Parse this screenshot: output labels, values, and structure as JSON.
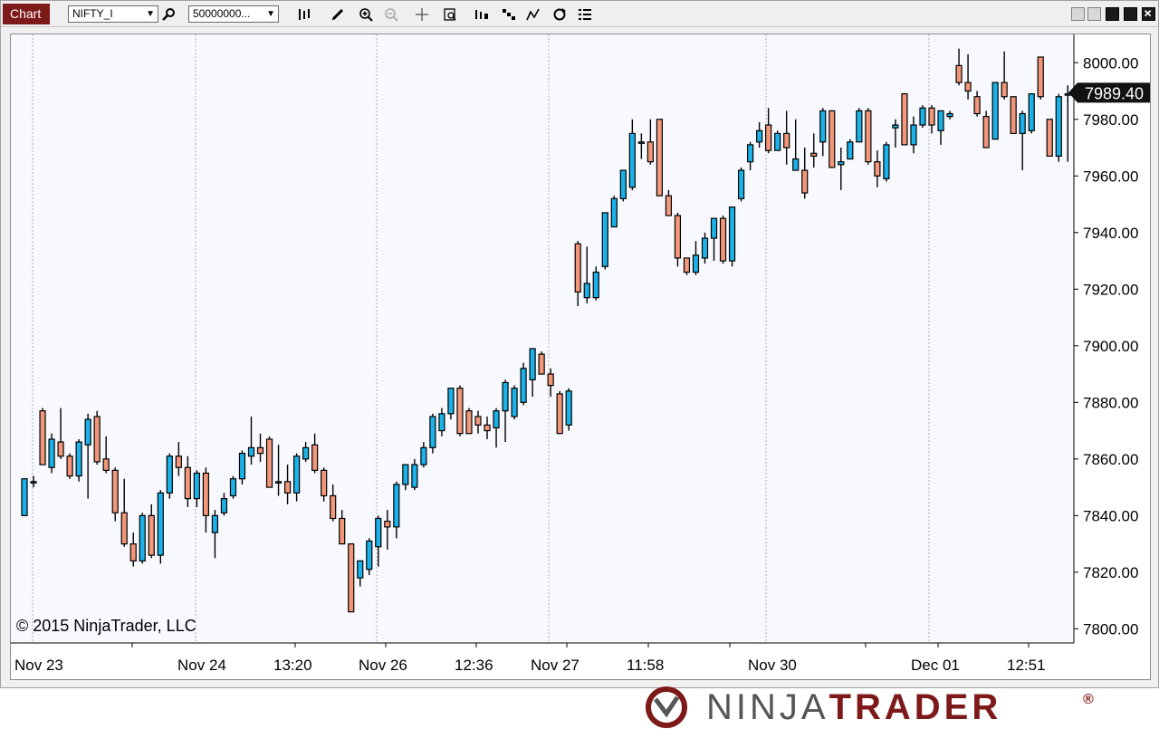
{
  "toolbar": {
    "tab_label": "Chart",
    "instrument_value": "NIFTY_I",
    "bartype_value": "50000000...",
    "icons": [
      "search-icon",
      "bars-type-icon",
      "pencil-icon",
      "zoom-in-icon",
      "zoom-out-icon",
      "crosshair-icon",
      "data-box-icon",
      "bar-spacing-icon",
      "chart-style-icon",
      "indicators-icon",
      "refresh-icon",
      "properties-icon"
    ]
  },
  "chart": {
    "copyright": "© 2015 NinjaTrader, LLC",
    "last_price_label": "7989.40"
  },
  "logo": {
    "part1": "NINJA",
    "part2": "TRADER",
    "reg": "®"
  },
  "colors": {
    "up": "#1ab2e8",
    "down": "#f2977a",
    "brand": "#7e1919",
    "grid": "#b0b0b0",
    "price_tag": "#111111"
  },
  "chart_data": {
    "type": "candlestick",
    "ylim": [
      7795,
      8010
    ],
    "y_ticks": [
      "7800.00",
      "7820.00",
      "7840.00",
      "7860.00",
      "7880.00",
      "7900.00",
      "7920.00",
      "7940.00",
      "7960.00",
      "7980.00",
      "8000.00"
    ],
    "x_labels": [
      "Nov 23",
      "Nov 24",
      "13:20",
      "Nov 26",
      "12:36",
      "Nov 27",
      "11:58",
      "Nov 30",
      "Dec 01",
      "12:51"
    ],
    "last_price": 7989.4,
    "bars": [
      [
        7840,
        7853,
        7840,
        7853
      ],
      [
        7852,
        7854,
        7850,
        7852
      ],
      [
        7877,
        7878,
        7858,
        7858
      ],
      [
        7857,
        7869,
        7855,
        7867
      ],
      [
        7866,
        7878,
        7860,
        7861
      ],
      [
        7861,
        7862,
        7853,
        7854
      ],
      [
        7854,
        7867,
        7852,
        7866
      ],
      [
        7865,
        7876,
        7846,
        7874
      ],
      [
        7875,
        7877,
        7858,
        7859
      ],
      [
        7860,
        7868,
        7855,
        7856
      ],
      [
        7856,
        7857,
        7838,
        7841
      ],
      [
        7841,
        7853,
        7829,
        7830
      ],
      [
        7830,
        7834,
        7822,
        7824
      ],
      [
        7824,
        7841,
        7823,
        7840
      ],
      [
        7840,
        7844,
        7825,
        7826
      ],
      [
        7826,
        7849,
        7823,
        7848
      ],
      [
        7848,
        7862,
        7846,
        7861
      ],
      [
        7861,
        7866,
        7854,
        7857
      ],
      [
        7857,
        7861,
        7843,
        7846
      ],
      [
        7846,
        7856,
        7843,
        7855
      ],
      [
        7855,
        7857,
        7834,
        7840
      ],
      [
        7834,
        7842,
        7825,
        7840
      ],
      [
        7841,
        7848,
        7840,
        7846
      ],
      [
        7847,
        7854,
        7846,
        7853
      ],
      [
        7853,
        7863,
        7851,
        7862
      ],
      [
        7861,
        7875,
        7858,
        7864
      ],
      [
        7864,
        7869,
        7859,
        7862
      ],
      [
        7867,
        7868,
        7850,
        7850
      ],
      [
        7852,
        7865,
        7847,
        7852
      ],
      [
        7852,
        7858,
        7844,
        7848
      ],
      [
        7848,
        7862,
        7845,
        7861
      ],
      [
        7860,
        7866,
        7859,
        7864
      ],
      [
        7865,
        7869,
        7855,
        7856
      ],
      [
        7856,
        7857,
        7845,
        7847
      ],
      [
        7847,
        7851,
        7838,
        7839
      ],
      [
        7839,
        7842,
        7830,
        7830
      ],
      [
        7830,
        7830,
        7806,
        7806
      ],
      [
        7818,
        7821,
        7815,
        7824
      ],
      [
        7821,
        7832,
        7819,
        7831
      ],
      [
        7829,
        7840,
        7822,
        7839
      ],
      [
        7838,
        7842,
        7828,
        7836
      ],
      [
        7836,
        7852,
        7832,
        7851
      ],
      [
        7851,
        7857,
        7849,
        7858
      ],
      [
        7850,
        7860,
        7849,
        7858
      ],
      [
        7858,
        7866,
        7857,
        7864
      ],
      [
        7864,
        7876,
        7862,
        7875
      ],
      [
        7870,
        7878,
        7868,
        7876
      ],
      [
        7876,
        7885,
        7874,
        7885
      ],
      [
        7885,
        7886,
        7868,
        7869
      ],
      [
        7877,
        7878,
        7869,
        7869
      ],
      [
        7875,
        7877,
        7869,
        7872
      ],
      [
        7872,
        7875,
        7867,
        7870
      ],
      [
        7871,
        7878,
        7864,
        7877
      ],
      [
        7877,
        7888,
        7866,
        7887
      ],
      [
        7875,
        7886,
        7874,
        7885
      ],
      [
        7880,
        7894,
        7879,
        7892
      ],
      [
        7888,
        7899,
        7882,
        7899
      ],
      [
        7897,
        7898,
        7890,
        7890
      ],
      [
        7890,
        7892,
        7882,
        7886
      ],
      [
        7883,
        7884,
        7869,
        7869
      ],
      [
        7872,
        7885,
        7870,
        7884
      ],
      [
        7936,
        7937,
        7914,
        7919
      ],
      [
        7917,
        7935,
        7915,
        7922
      ],
      [
        7917,
        7928,
        7916,
        7926
      ],
      [
        7928,
        7947,
        7927,
        7947
      ],
      [
        7942,
        7953,
        7942,
        7952
      ],
      [
        7952,
        7962,
        7951,
        7962
      ],
      [
        7956,
        7980,
        7955,
        7975
      ],
      [
        7972,
        7975,
        7966,
        7972
      ],
      [
        7972,
        7980,
        7964,
        7965
      ],
      [
        7980,
        7980,
        7953,
        7953
      ],
      [
        7953,
        7955,
        7946,
        7946
      ],
      [
        7946,
        7947,
        7928,
        7931
      ],
      [
        7931,
        7931,
        7925,
        7926
      ],
      [
        7926,
        7937,
        7925,
        7932
      ],
      [
        7931,
        7940,
        7929,
        7938
      ],
      [
        7938,
        7945,
        7930,
        7945
      ],
      [
        7945,
        7946,
        7929,
        7930
      ],
      [
        7930,
        7948,
        7928,
        7949
      ],
      [
        7952,
        7963,
        7951,
        7962
      ],
      [
        7965,
        7972,
        7962,
        7971
      ],
      [
        7972,
        7979,
        7970,
        7976
      ],
      [
        7978,
        7984,
        7968,
        7969
      ],
      [
        7969,
        7976,
        7969,
        7975
      ],
      [
        7975,
        7983,
        7964,
        7970
      ],
      [
        7962,
        7980,
        7962,
        7966
      ],
      [
        7962,
        7970,
        7952,
        7954
      ],
      [
        7968,
        7975,
        7963,
        7967
      ],
      [
        7972,
        7984,
        7967,
        7983
      ],
      [
        7983,
        7983,
        7963,
        7963
      ],
      [
        7964,
        7970,
        7955,
        7965
      ],
      [
        7966,
        7973,
        7966,
        7972
      ],
      [
        7972,
        7984,
        7972,
        7983
      ],
      [
        7983,
        7984,
        7964,
        7965
      ],
      [
        7965,
        7969,
        7956,
        7960
      ],
      [
        7959,
        7972,
        7958,
        7971
      ],
      [
        7977,
        7980,
        7970,
        7978
      ],
      [
        7989,
        7989,
        7972,
        7971
      ],
      [
        7971,
        7981,
        7968,
        7978
      ],
      [
        7978,
        7985,
        7977,
        7984
      ],
      [
        7984,
        7985,
        7975,
        7978
      ],
      [
        7976,
        7983,
        7971,
        7983
      ],
      [
        7981,
        7983,
        7980,
        7982
      ],
      [
        7999,
        8005,
        7992,
        7993
      ],
      [
        7993,
        8003,
        7987,
        7990
      ],
      [
        7988,
        7990,
        7981,
        7982
      ],
      [
        7981,
        7983,
        7970,
        7970
      ],
      [
        7973,
        7993,
        7973,
        7993
      ],
      [
        7993,
        8004,
        7987,
        7988
      ],
      [
        7988,
        7988,
        7975,
        7975
      ],
      [
        7975,
        7983,
        7962,
        7982
      ],
      [
        7976,
        7989,
        7975,
        7989
      ],
      [
        8002,
        8002,
        7987,
        7988
      ],
      [
        7980,
        7980,
        7967,
        7967
      ],
      [
        7967,
        7989,
        7965,
        7988
      ],
      [
        7989,
        7992,
        7965,
        7989
      ]
    ]
  }
}
